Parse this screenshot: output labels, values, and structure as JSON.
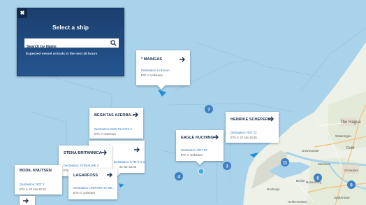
{
  "panel": {
    "close_icon": "close-icon",
    "title": "Select a ship",
    "search_placeholder": "Search by Name",
    "note": "Expected vessel arrivals in the next 48 hours"
  },
  "ships": [
    {
      "name": "* MAINGAS",
      "destination": "Destination: Unknown",
      "eta": "ETA ⊙ Unknown"
    },
    {
      "name": "BESIKTAS AZERBA...",
      "destination": "Destination: EMO PLANTS 3",
      "eta": "ETA ⊙ Unknown"
    },
    {
      "name": "HENRIKE SCHEPERS",
      "destination": "Destination: RST 22",
      "eta": "ETA ⊙ 22 Jan 16:45"
    },
    {
      "name": "EAGLE KUCHING",
      "destination": "Destination: RET 03",
      "eta": "ETA ⊙ Unknown"
    },
    {
      "name": "STENA BRITANNICA",
      "destination": "Destination: STENALINE 2",
      "eta": "ETA ⊙ Unknown"
    },
    {
      "name": "LAGARFOSS",
      "destination": "Destination: UNIPORT 22 WE...",
      "eta": "ETA ⊙ Unknown"
    },
    {
      "name": "BODIL KNUTSEN",
      "destination": "Destination: ROT 2",
      "eta": "ETA ⊙ 22 Jan 20:13"
    },
    {
      "destination": "Destination: KTM STL 5",
      "eta": "22 Jan 16:40"
    }
  ],
  "clusters": [
    "7",
    "3",
    "4",
    "11",
    "8",
    "9"
  ],
  "places": [
    "The Hague",
    "Wateringen",
    "Delft",
    "Gravesande",
    "Maasluis",
    "Schiedam",
    "Rozenburg",
    "Brielle",
    "Rockanje",
    "Spijkenisse",
    "Hellevoetsluis"
  ],
  "colors": {
    "panel": "#1f4a80",
    "cluster": "#3f7fc3",
    "ship": "#1c90d8",
    "sea": "#a9d3ea",
    "land": "#eef1e7"
  }
}
